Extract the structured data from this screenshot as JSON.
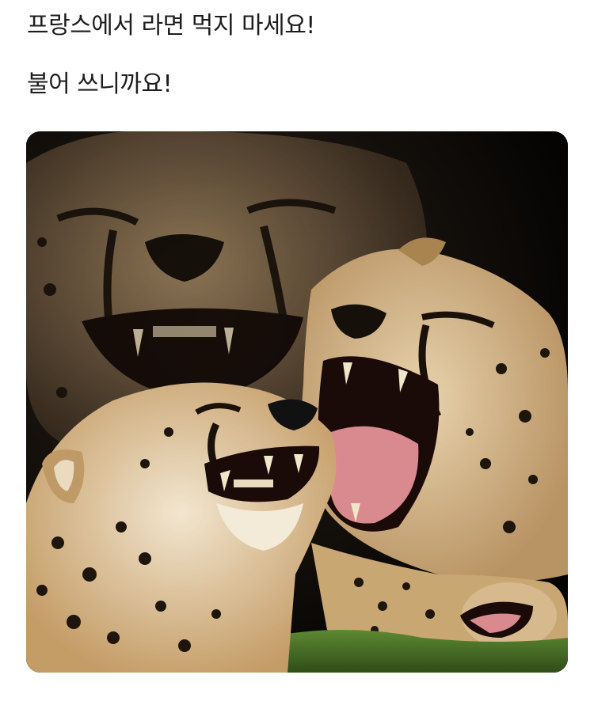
{
  "post": {
    "line1": "프랑스에서 라면 먹지 마세요!",
    "line2": "불어 쓰니까요!"
  },
  "image": {
    "subject": "laughing-cheetahs-photo",
    "colors": {
      "background": "#050403",
      "fur_light": "#e9d8b8",
      "fur_mid": "#c9a773",
      "fur_dark": "#8a6a3e",
      "spots": "#1e150d",
      "mouth": "#1a0a08",
      "tongue": "#d98a8f",
      "teeth": "#f0e6c8",
      "grass": "#4f7a2c"
    }
  }
}
